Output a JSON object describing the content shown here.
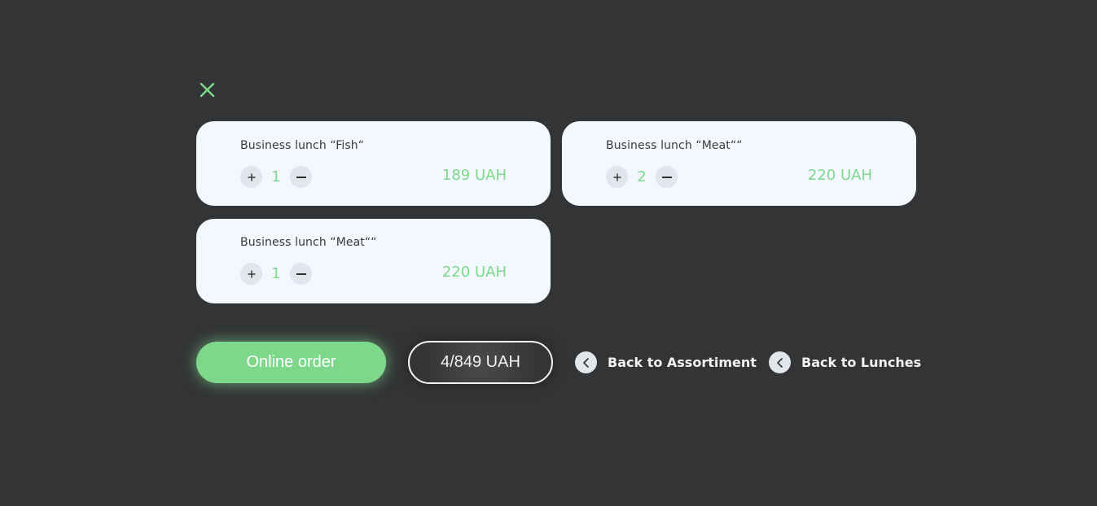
{
  "cart": {
    "items": [
      {
        "title": "Business lunch “Fish“",
        "quantity": "1",
        "price": "189 UAH"
      },
      {
        "title": "Business lunch “Meat““",
        "quantity": "2",
        "price": "220 UAH"
      },
      {
        "title": "Business lunch “Meat““",
        "quantity": "1",
        "price": "220 UAH"
      }
    ]
  },
  "footer": {
    "order_label": "Online order",
    "total": "4/849 UAH",
    "back_assortment": "Back to Assortiment",
    "back_lunches": "Back to Lunches"
  },
  "icons": {
    "close": "close-icon",
    "plus": "plus-icon",
    "minus": "minus-icon",
    "back": "chevron-left-icon"
  },
  "colors": {
    "background": "#333436",
    "card": "#f2f8fd",
    "accent": "#7dd88c",
    "button_bg": "#e1e5ec",
    "text_light": "#f2f2f2",
    "text_dark": "#3a3a3c"
  }
}
